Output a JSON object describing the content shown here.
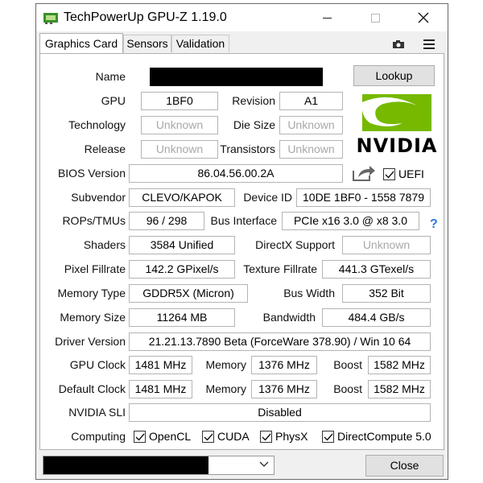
{
  "window": {
    "title": "TechPowerUp GPU-Z 1.19.0"
  },
  "tabs": [
    {
      "label": "Graphics Card",
      "active": true
    },
    {
      "label": "Sensors",
      "active": false
    },
    {
      "label": "Validation",
      "active": false
    }
  ],
  "toolbar": {
    "camera_icon": "camera-icon",
    "menu_icon": "hamburger-menu-icon"
  },
  "labels": {
    "name": "Name",
    "gpu": "GPU",
    "revision": "Revision",
    "technology": "Technology",
    "die_size": "Die Size",
    "release": "Release",
    "transistors": "Transistors",
    "bios_version": "BIOS Version",
    "subvendor": "Subvendor",
    "device_id": "Device ID",
    "rops_tmus": "ROPs/TMUs",
    "bus_interface": "Bus Interface",
    "shaders": "Shaders",
    "directx_support": "DirectX Support",
    "pixel_fillrate": "Pixel Fillrate",
    "texture_fillrate": "Texture Fillrate",
    "memory_type": "Memory Type",
    "bus_width": "Bus Width",
    "memory_size": "Memory Size",
    "bandwidth": "Bandwidth",
    "driver_version": "Driver Version",
    "gpu_clock": "GPU Clock",
    "memory": "Memory",
    "boost": "Boost",
    "default_clock": "Default Clock",
    "nvidia_sli": "NVIDIA SLI",
    "computing": "Computing"
  },
  "values": {
    "name": "",
    "gpu": "1BF0",
    "revision": "A1",
    "technology": "Unknown",
    "die_size": "Unknown",
    "release": "Unknown",
    "transistors": "Unknown",
    "bios_version": "86.04.56.00.2A",
    "subvendor": "CLEVO/KAPOK",
    "device_id": "10DE 1BF0 - 1558 7879",
    "rops_tmus": "96 / 298",
    "bus_interface": "PCIe x16 3.0 @ x8 3.0",
    "shaders": "3584 Unified",
    "directx_support": "Unknown",
    "pixel_fillrate": "142.2 GPixel/s",
    "texture_fillrate": "441.3 GTexel/s",
    "memory_type": "GDDR5X (Micron)",
    "bus_width": "352 Bit",
    "memory_size": "11264 MB",
    "bandwidth": "484.4 GB/s",
    "driver_version": "21.21.13.7890 Beta (ForceWare 378.90) / Win 10 64",
    "gpu_clock": "1481 MHz",
    "gpu_memory_clock": "1376 MHz",
    "gpu_boost_clock": "1582 MHz",
    "default_clock": "1481 MHz",
    "default_memory_clock": "1376 MHz",
    "default_boost_clock": "1582 MHz",
    "nvidia_sli": "Disabled"
  },
  "buttons": {
    "lookup": "Lookup",
    "close": "Close"
  },
  "uefi": {
    "label": "UEFI",
    "checked": true
  },
  "computing": [
    {
      "label": "OpenCL",
      "checked": true
    },
    {
      "label": "CUDA",
      "checked": true
    },
    {
      "label": "PhysX",
      "checked": true
    },
    {
      "label": "DirectCompute 5.0",
      "checked": true
    }
  ],
  "logo": {
    "brand": "NVIDIA",
    "brand_color": "#76b900"
  },
  "bottom_select": {
    "value": ""
  },
  "help_glyph": "?"
}
